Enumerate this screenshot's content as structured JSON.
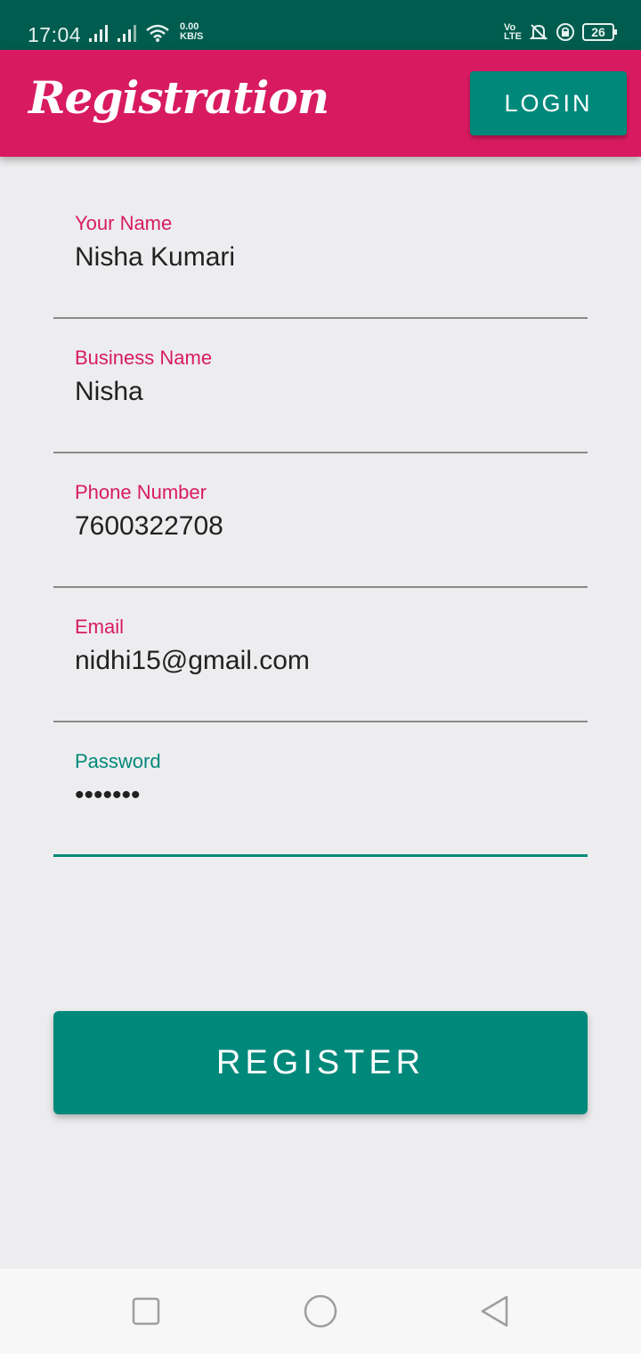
{
  "status_bar": {
    "time": "17:04",
    "net_speed_value": "0.00",
    "net_speed_unit": "KB/S",
    "volte_top": "Vo",
    "volte_bottom": "LTE",
    "battery": "26"
  },
  "app_bar": {
    "title": "Registration",
    "login_label": "LOGIN"
  },
  "form": {
    "fields": [
      {
        "label": "Your Name",
        "value": "Nisha Kumari"
      },
      {
        "label": "Business Name",
        "value": "Nisha"
      },
      {
        "label": "Phone Number",
        "value": "7600322708"
      },
      {
        "label": "Email",
        "value": "nidhi15@gmail.com"
      },
      {
        "label": "Password",
        "value": "•••••••"
      }
    ],
    "register_label": "REGISTER"
  },
  "colors": {
    "status_bar": "#005c4e",
    "primary": "#d81b60",
    "accent": "#00897b",
    "background": "#ededef"
  },
  "nav_bar": {
    "icons": [
      "recents-square-icon",
      "home-circle-icon",
      "back-triangle-icon"
    ]
  }
}
